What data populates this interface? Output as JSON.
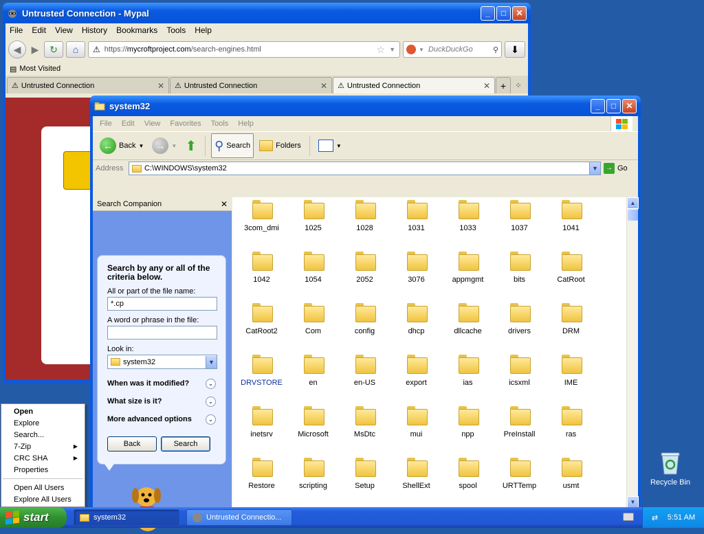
{
  "desktop": {
    "recycle_bin_label": "Recycle Bin"
  },
  "firefox": {
    "title": "Untrusted Connection - Mypal",
    "menu": [
      "File",
      "Edit",
      "View",
      "History",
      "Bookmarks",
      "Tools",
      "Help"
    ],
    "url_prefix": "https://",
    "url_domain": "mycroftproject.com",
    "url_path": "/search-engines.html",
    "search_placeholder": "DuckDuckGo",
    "bookmark": "Most Visited",
    "tabs": [
      "Untrusted Connection",
      "Untrusted Connection",
      "Untrusted Connection"
    ]
  },
  "explorer": {
    "title": "system32",
    "menu": [
      "File",
      "Edit",
      "View",
      "Favorites",
      "Tools",
      "Help"
    ],
    "toolbar": {
      "back": "Back",
      "search": "Search",
      "folders": "Folders"
    },
    "address_label": "Address",
    "address_value": "C:\\WINDOWS\\system32",
    "go_label": "Go",
    "search_companion": {
      "title": "Search Companion",
      "heading": "Search by any or all of the criteria below.",
      "name_label": "All or part of the file name:",
      "name_value": "*.cp",
      "phrase_label": "A word or phrase in the file:",
      "phrase_value": "",
      "look_in_label": "Look in:",
      "look_in_value": "system32",
      "options": [
        "When was it modified?",
        "What size is it?",
        "More advanced options"
      ],
      "back_button": "Back",
      "search_button": "Search"
    },
    "files": [
      [
        "3com_dmi",
        "1025",
        "1028",
        "1031",
        "1033",
        "1037",
        "1041"
      ],
      [
        "1042",
        "1054",
        "2052",
        "3076",
        "appmgmt",
        "bits",
        "CatRoot"
      ],
      [
        "CatRoot2",
        "Com",
        "config",
        "dhcp",
        "dllcache",
        "drivers",
        "DRM"
      ],
      [
        "DRVSTORE",
        "en",
        "en-US",
        "export",
        "ias",
        "icsxml",
        "IME"
      ],
      [
        "inetsrv",
        "Microsoft",
        "MsDtc",
        "mui",
        "npp",
        "PreInstall",
        "ras"
      ],
      [
        "Restore",
        "scripting",
        "Setup",
        "ShellExt",
        "spool",
        "URTTemp",
        "usmt"
      ]
    ]
  },
  "context_menu": {
    "items": [
      {
        "label": "Open",
        "bold": true,
        "submenu": false
      },
      {
        "label": "Explore",
        "submenu": false
      },
      {
        "label": "Search...",
        "submenu": false
      },
      {
        "label": "7-Zip",
        "submenu": true
      },
      {
        "label": "CRC SHA",
        "submenu": true
      },
      {
        "label": "Properties",
        "submenu": false
      },
      {
        "label": "---"
      },
      {
        "label": "Open All Users",
        "submenu": false
      },
      {
        "label": "Explore All Users",
        "submenu": false
      }
    ]
  },
  "taskbar": {
    "start_label": "start",
    "tasks": [
      "system32",
      "Untrusted Connectio..."
    ],
    "clock": "5:51 AM"
  }
}
